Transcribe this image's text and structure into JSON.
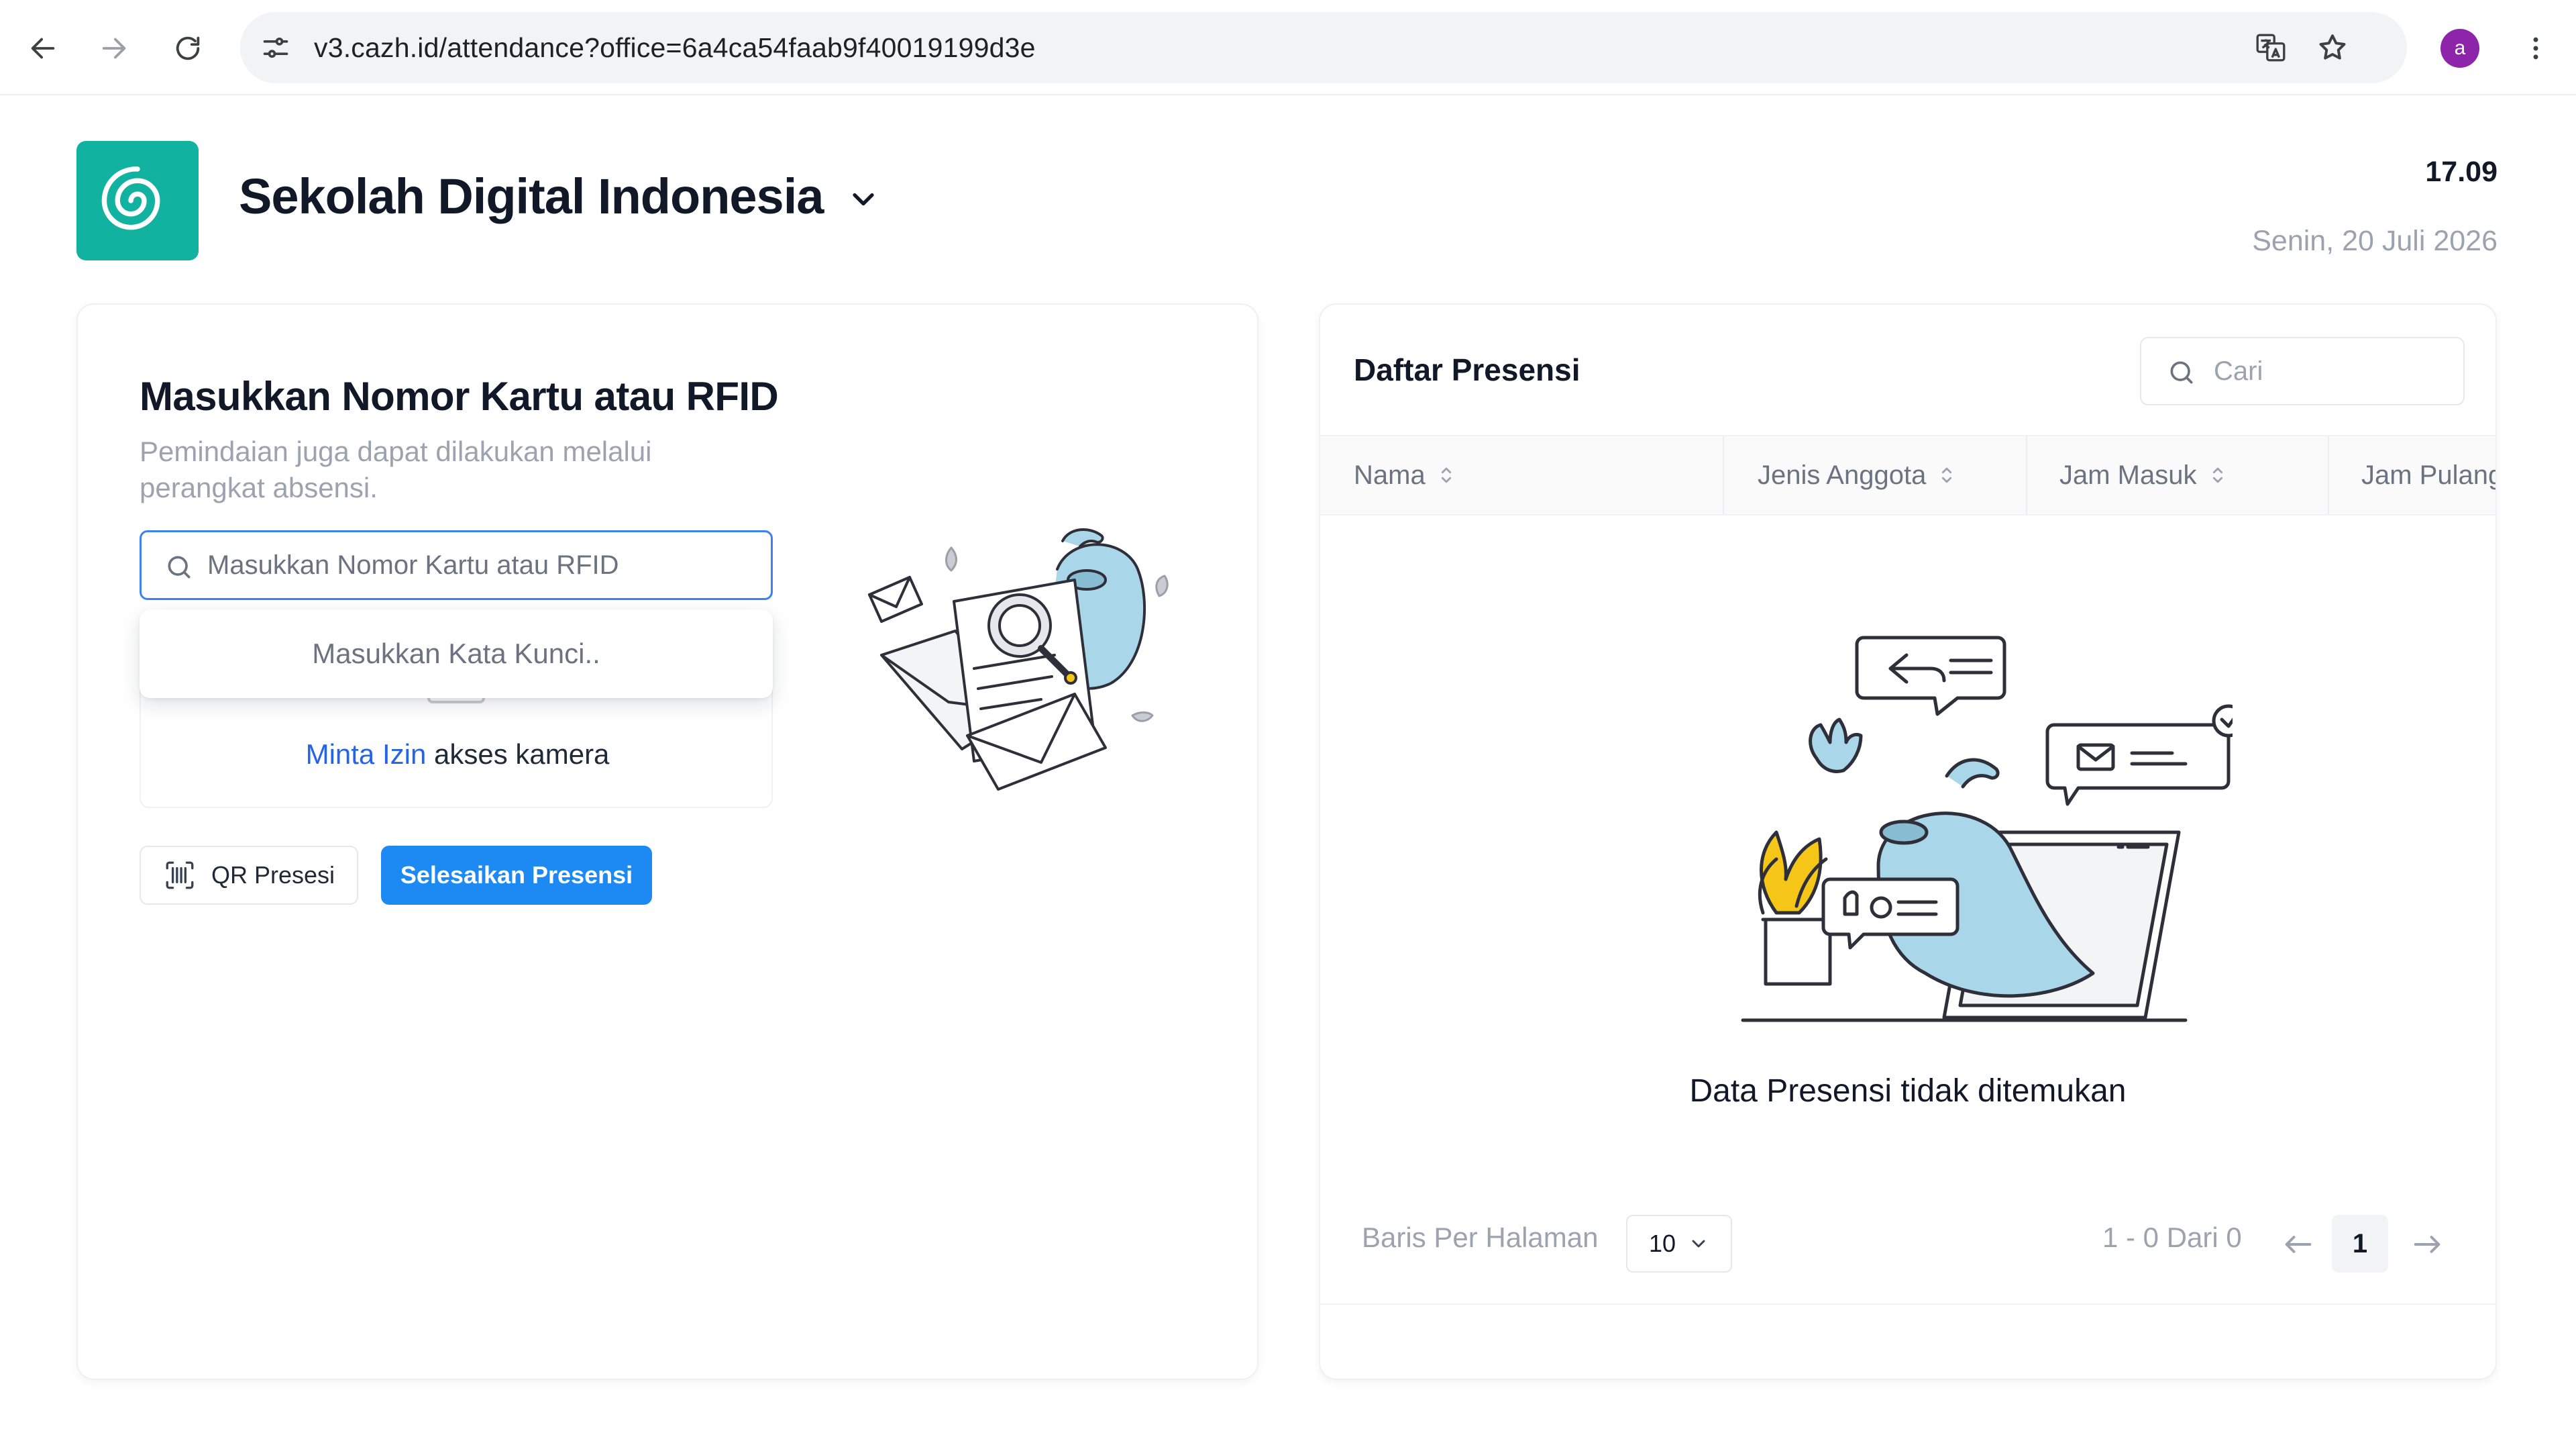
{
  "browser": {
    "url": "v3.cazh.id/attendance?office=6a4ca54faab9f40019199d3e",
    "profile_initial": "a"
  },
  "header": {
    "org_name": "Sekolah Digital Indonesia",
    "time": "17.09",
    "date": "Senin, 20 Juli 2026"
  },
  "scan_panel": {
    "title": "Masukkan Nomor Kartu atau RFID",
    "subtitle": "Pemindaian juga dapat dilakukan melalui perangkat absensi.",
    "input_placeholder": "Masukkan Nomor Kartu atau RFID",
    "suggestion_placeholder": "Masukkan Kata Kunci..",
    "camera_link": "Minta Izin",
    "camera_text": "akses kamera",
    "qr_button": "QR Presesi",
    "finish_button": "Selesaikan Presensi"
  },
  "attendance_list": {
    "title": "Daftar Presensi",
    "search_placeholder": "Cari",
    "columns": [
      "Nama",
      "Jenis Anggota",
      "Jam Masuk",
      "Jam Pulang"
    ],
    "empty_message": "Data Presensi tidak ditemukan",
    "rows_per_page_label": "Baris Per Halaman",
    "rows_per_page": "10",
    "page_info": "1 - 0 Dari 0",
    "current_page": "1"
  },
  "colors": {
    "brand": "#12b2a0",
    "primary": "#1d8af4",
    "link": "#2563eb"
  }
}
